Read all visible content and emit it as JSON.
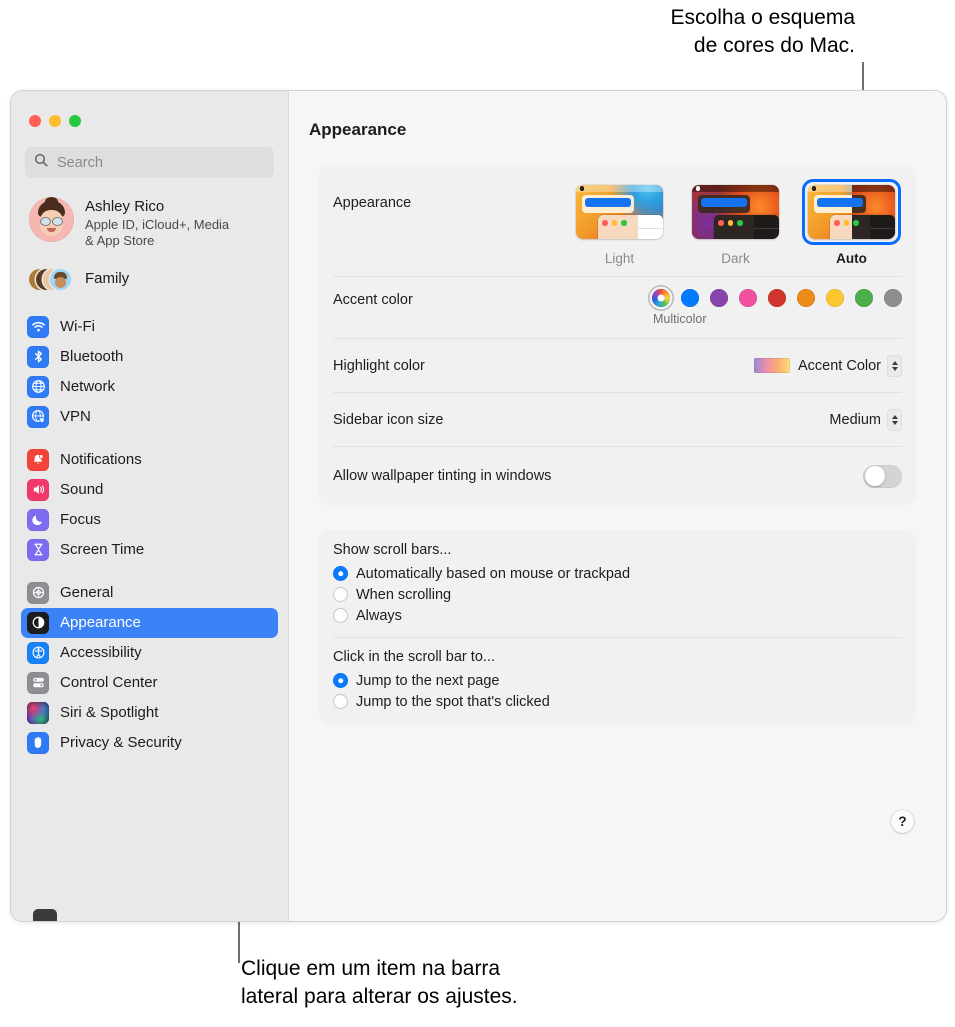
{
  "callouts": {
    "top": "Escolha o esquema\nde cores do Mac.",
    "bottom": "Clique em um item na barra\nlateral para alterar os ajustes."
  },
  "window": {
    "traffic_lights": [
      "close",
      "minimize",
      "zoom"
    ]
  },
  "sidebar": {
    "search": {
      "placeholder": "Search",
      "value": "",
      "icon": "search-icon"
    },
    "account": {
      "name": "Ashley Rico",
      "subtitle": "Apple ID, iCloud+, Media\n& App Store"
    },
    "family": {
      "label": "Family"
    },
    "groups": [
      {
        "items": [
          {
            "label": "Wi-Fi",
            "icon": "wifi-icon",
            "color": "#2f7bf6"
          },
          {
            "label": "Bluetooth",
            "icon": "bluetooth-icon",
            "color": "#2f7bf6"
          },
          {
            "label": "Network",
            "icon": "globe-icon",
            "color": "#2f7bf6"
          },
          {
            "label": "VPN",
            "icon": "vpn-globe-icon",
            "color": "#2f7bf6"
          }
        ]
      },
      {
        "items": [
          {
            "label": "Notifications",
            "icon": "bell-icon",
            "color": "#f4443a"
          },
          {
            "label": "Sound",
            "icon": "speaker-icon",
            "color": "#f2386b"
          },
          {
            "label": "Focus",
            "icon": "moon-icon",
            "color": "#7c6df0"
          },
          {
            "label": "Screen Time",
            "icon": "hourglass-icon",
            "color": "#7c6df0"
          }
        ]
      },
      {
        "items": [
          {
            "label": "General",
            "icon": "gear-icon",
            "color": "#8e8e93"
          },
          {
            "label": "Appearance",
            "icon": "appearance-icon",
            "color": "#1c1c1e",
            "selected": true
          },
          {
            "label": "Accessibility",
            "icon": "accessibility-icon",
            "color": "#1a82f7"
          },
          {
            "label": "Control Center",
            "icon": "control-center-icon",
            "color": "#8e8e93"
          },
          {
            "label": "Siri & Spotlight",
            "icon": "siri-icon",
            "color": "#2b1f3a"
          },
          {
            "label": "Privacy & Security",
            "icon": "hand-icon",
            "color": "#2f7bf6"
          }
        ]
      }
    ],
    "selected_color": "#3b82f6"
  },
  "content": {
    "title": "Appearance",
    "appearance": {
      "label": "Appearance",
      "options": [
        {
          "label": "Light",
          "selected": false
        },
        {
          "label": "Dark",
          "selected": false
        },
        {
          "label": "Auto",
          "selected": true
        }
      ]
    },
    "accent_color": {
      "label": "Accent color",
      "caption": "Multicolor",
      "swatches": [
        {
          "name": "Multicolor",
          "color": "multicolor",
          "selected": true
        },
        {
          "name": "Blue",
          "color": "#007AFF"
        },
        {
          "name": "Purple",
          "color": "#8944AB"
        },
        {
          "name": "Pink",
          "color": "#F2519F"
        },
        {
          "name": "Red",
          "color": "#D0342C"
        },
        {
          "name": "Orange",
          "color": "#ED8A19"
        },
        {
          "name": "Yellow",
          "color": "#FDC82F"
        },
        {
          "name": "Green",
          "color": "#4CAF4C"
        },
        {
          "name": "Graphite",
          "color": "#8E8E8E"
        }
      ]
    },
    "highlight_color": {
      "label": "Highlight color",
      "value": "Accent Color"
    },
    "sidebar_icon_size": {
      "label": "Sidebar icon size",
      "value": "Medium"
    },
    "wallpaper_tinting": {
      "label": "Allow wallpaper tinting in windows",
      "enabled": false
    },
    "scroll_bars": {
      "title": "Show scroll bars...",
      "options": [
        {
          "label": "Automatically based on mouse or trackpad",
          "selected": true
        },
        {
          "label": "When scrolling",
          "selected": false
        },
        {
          "label": "Always",
          "selected": false
        }
      ]
    },
    "scroll_click": {
      "title": "Click in the scroll bar to...",
      "options": [
        {
          "label": "Jump to the next page",
          "selected": true
        },
        {
          "label": "Jump to the spot that's clicked",
          "selected": false
        }
      ]
    },
    "help_label": "?"
  }
}
